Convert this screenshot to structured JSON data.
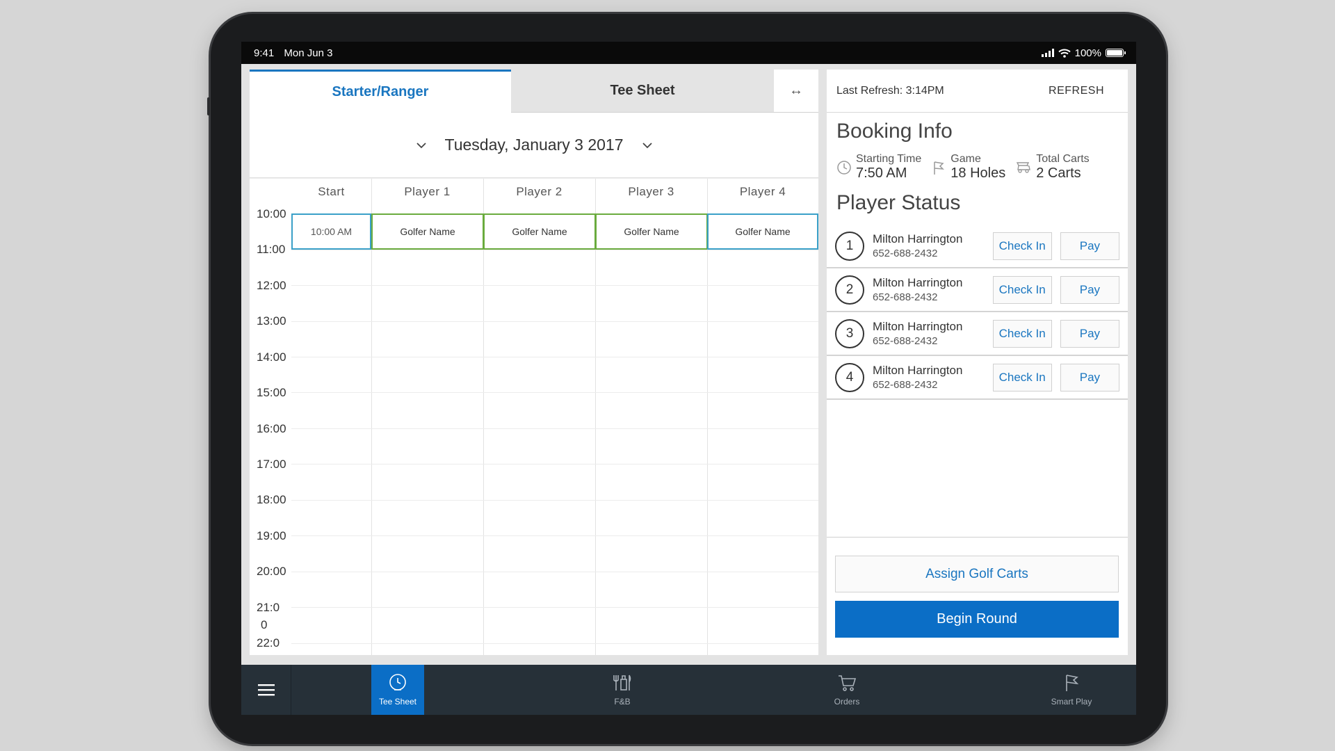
{
  "status_bar": {
    "time": "9:41",
    "date": "Mon Jun 3",
    "battery": "100%"
  },
  "tabs": {
    "starter": "Starter/Ranger",
    "tee_sheet": "Tee Sheet",
    "expand_symbol": "↔"
  },
  "date_picker": {
    "date": "Tuesday, January 3 2017"
  },
  "grid": {
    "columns": [
      "Start",
      "Player 1",
      "Player 2",
      "Player 3",
      "Player 4"
    ],
    "times": [
      "10:00",
      "11:00",
      "12:00",
      "13:00",
      "14:00",
      "15:00",
      "16:00",
      "17:00",
      "18:00",
      "19:00",
      "20:00",
      "21:0",
      "0",
      "22:0"
    ],
    "booking": {
      "start": "10:00 AM",
      "players": [
        "Golfer Name",
        "Golfer Name",
        "Golfer Name",
        "Golfer Name"
      ]
    }
  },
  "right_panel": {
    "last_refresh": "Last Refresh: 3:14PM",
    "refresh_label": "REFRESH",
    "booking_title": "Booking Info",
    "booking_info": {
      "starting_time_label": "Starting Time",
      "starting_time": "7:50 AM",
      "game_label": "Game",
      "game": "18 Holes",
      "carts_label": "Total Carts",
      "carts": "2 Carts"
    },
    "player_status_title": "Player Status",
    "players": [
      {
        "num": "1",
        "name": "Milton Harrington",
        "phone": "652-688-2432"
      },
      {
        "num": "2",
        "name": "Milton Harrington",
        "phone": "652-688-2432"
      },
      {
        "num": "3",
        "name": "Milton Harrington",
        "phone": "652-688-2432"
      },
      {
        "num": "4",
        "name": "Milton Harrington",
        "phone": "652-688-2432"
      }
    ],
    "check_in_label": "Check In",
    "pay_label": "Pay",
    "assign_label": "Assign Golf Carts",
    "begin_label": "Begin Round"
  },
  "bottom_nav": {
    "tee_sheet": "Tee Sheet",
    "fnb": "F&B",
    "orders": "Orders",
    "smart_play": "Smart Play"
  },
  "colors": {
    "accent": "#0b6ec6",
    "tab_accent": "#1a76c0",
    "booking_start_border": "#3aa0c8",
    "booking_player_border": "#6aab3e",
    "nav_bg": "#263038"
  },
  "icons": [
    "clock-icon",
    "flag-icon",
    "golf-cart-icon",
    "chevron-down-icon",
    "menu-icon",
    "tee-sheet-icon",
    "fnb-icon",
    "cart-icon",
    "smart-play-flag-icon",
    "wifi-icon",
    "signal-icon",
    "battery-icon"
  ]
}
